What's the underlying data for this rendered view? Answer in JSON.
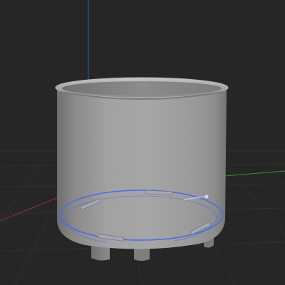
{
  "viewport": {
    "background_color": "#262626",
    "grid_color": "#303030",
    "axis_x_color": "#8a3a3a",
    "axis_y_color": "#3a8a3a",
    "axis_z_color": "#3a5a9a"
  },
  "model": {
    "shape": "cylindrical bucket with rolled rim and feet",
    "body_color": "#9a9a9a",
    "selection_edge_color": "#4a6ee0"
  }
}
